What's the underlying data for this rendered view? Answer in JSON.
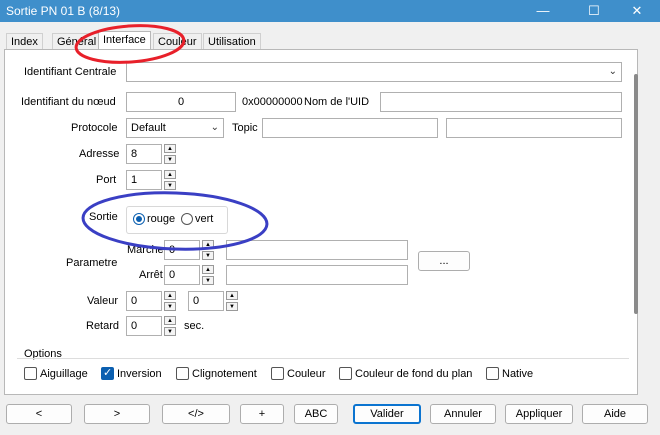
{
  "window": {
    "title": "Sortie PN 01 B (8/13)",
    "minimize": "—",
    "maximize": "☐",
    "close": "✕"
  },
  "tabs": [
    {
      "label": "Index"
    },
    {
      "label": "Général"
    },
    {
      "label": "Interface"
    },
    {
      "label": "Couleur"
    },
    {
      "label": "Utilisation"
    }
  ],
  "form": {
    "identifiant_centrale_label": "Identifiant Centrale",
    "identifiant_centrale_value": "",
    "identifiant_noeud_label": "Identifiant du nœud",
    "identifiant_noeud_value": "0",
    "hex_value": "0x00000000",
    "nom_uid_label": "Nom de l'UID",
    "nom_uid_value": "",
    "protocole_label": "Protocole",
    "protocole_value": "Default",
    "topic_label": "Topic",
    "topic_value": "",
    "topic_value2": "",
    "adresse_label": "Adresse",
    "adresse_value": "8",
    "port_label": "Port",
    "port_value": "1",
    "sortie_label": "Sortie",
    "sortie_options": [
      "rouge",
      "vert"
    ],
    "sortie_selected": "rouge",
    "parametre_label": "Parametre",
    "marche_label": "Marche",
    "marche_value": "0",
    "marche_text": "",
    "arret_label": "Arrêt",
    "arret_value": "0",
    "arret_text": "",
    "browse_label": "...",
    "valeur_label": "Valeur",
    "valeur_value1": "0",
    "valeur_value2": "0",
    "retard_label": "Retard",
    "retard_value": "0",
    "retard_unit": "sec."
  },
  "options": {
    "title": "Options",
    "items": [
      {
        "label": "Aiguillage",
        "checked": false
      },
      {
        "label": "Inversion",
        "checked": true
      },
      {
        "label": "Clignotement",
        "checked": false
      },
      {
        "label": "Couleur",
        "checked": false
      },
      {
        "label": "Couleur de fond du plan",
        "checked": false
      },
      {
        "label": "Native",
        "checked": false
      }
    ]
  },
  "buttons": {
    "prev": "<",
    "next": ">",
    "code": "</>",
    "plus": "+",
    "abc": "ABC",
    "valider": "Valider",
    "annuler": "Annuler",
    "appliquer": "Appliquer",
    "aide": "Aide"
  },
  "icons": {
    "dropdown": "chevron-down-icon",
    "spin_up": "▲",
    "spin_down": "▼"
  },
  "colors": {
    "titlebar": "#3f8fcb",
    "annotation_red": "#e8202a",
    "annotation_blue": "#3a3fc4",
    "accent": "#0b5fb0"
  }
}
